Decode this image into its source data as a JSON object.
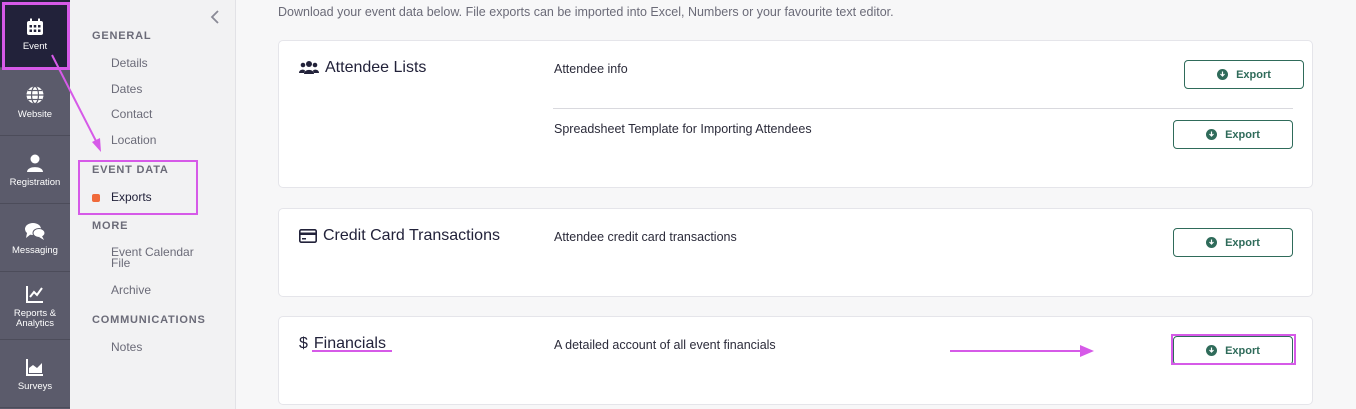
{
  "rail": {
    "items": [
      {
        "label": "Event",
        "icon": "calendar-icon"
      },
      {
        "label": "Website",
        "icon": "globe-icon"
      },
      {
        "label": "Registration",
        "icon": "person-icon"
      },
      {
        "label": "Messaging",
        "icon": "chat-icon"
      },
      {
        "label": "Reports & Analytics",
        "icon": "chart-icon"
      },
      {
        "label": "Surveys",
        "icon": "survey-icon"
      }
    ]
  },
  "subnav": {
    "general": "GENERAL",
    "details": "Details",
    "dates": "Dates",
    "contact": "Contact",
    "location": "Location",
    "event_data": "EVENT DATA",
    "exports": "Exports",
    "more": "MORE",
    "calendar_line1": "Event Calendar",
    "calendar_line2": "File",
    "archive": "Archive",
    "communications": "COMMUNICATIONS",
    "notes": "Notes"
  },
  "main": {
    "intro": "Download your event data below. File exports can be imported into Excel, Numbers or your favourite text editor.",
    "export_label": "Export",
    "cards": {
      "attendee": {
        "title": "Attendee Lists",
        "row1": "Attendee info",
        "row2": "Spreadsheet Template for Importing Attendees"
      },
      "credit": {
        "title": "Credit Card Transactions",
        "row1": "Attendee credit card transactions"
      },
      "financials": {
        "title": "Financials",
        "symbol": "$",
        "row1": "A detailed account of all event financials"
      }
    }
  },
  "colors": {
    "accent": "#2f6b5a",
    "annotation": "#d65ae8",
    "rail": "#5b5b6b",
    "rail_active": "#22223a",
    "active_dot": "#f06a3a"
  }
}
